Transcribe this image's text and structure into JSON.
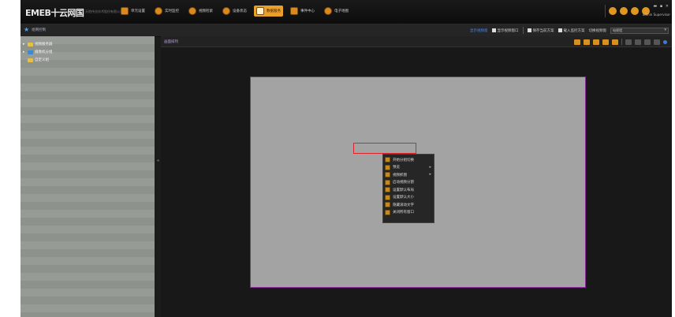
{
  "app": {
    "logo": "EMEB十云网国",
    "logo_sub": "天地伟业技术股份有限公司"
  },
  "topnav": [
    {
      "label": "单元设置",
      "icon": "grid-icon"
    },
    {
      "label": "实时监控",
      "icon": "camera-icon"
    },
    {
      "label": "视频检索",
      "icon": "playback-icon"
    },
    {
      "label": "设备状态",
      "icon": "status-icon"
    },
    {
      "label": "数据服务",
      "icon": "data-icon",
      "active": true
    },
    {
      "label": "事件中心",
      "icon": "event-icon"
    },
    {
      "label": "电子地图",
      "icon": "map-icon"
    }
  ],
  "top_right": {
    "window_controls": "▬ ▪ ✕",
    "user": "admin Supervisor"
  },
  "secbar": {
    "title": "组网控制",
    "right_items": [
      {
        "label": "显示视频窗",
        "highlight": true
      },
      {
        "label": "显示视频窗口"
      },
      {
        "label": "保存当前方案"
      },
      {
        "label": "载入监控方案"
      },
      {
        "label": "切换视频窗"
      }
    ],
    "select_value": "电视墙"
  },
  "sidebar": {
    "items": [
      {
        "label": "视频服务器",
        "arrow": "▸",
        "icon": "folder"
      },
      {
        "label": "摄像机分组",
        "arrow": "▸",
        "icon": "camera"
      },
      {
        "label": "自定义组",
        "arrow": "",
        "icon": "folder"
      }
    ]
  },
  "main": {
    "title": "画面排列"
  },
  "context_menu": {
    "items": [
      {
        "label": "开始分组切换",
        "sub": false
      },
      {
        "label": "预览",
        "sub": true
      },
      {
        "label": "视频抓图",
        "sub": true
      },
      {
        "label": "启动视频分割",
        "sub": false
      },
      {
        "label": "设置默认布局",
        "sub": false
      },
      {
        "label": "设置默认大小",
        "sub": false
      },
      {
        "label": "隐藏滚动文字",
        "sub": false
      },
      {
        "label": "关闭所有窗口",
        "sub": false
      }
    ]
  }
}
